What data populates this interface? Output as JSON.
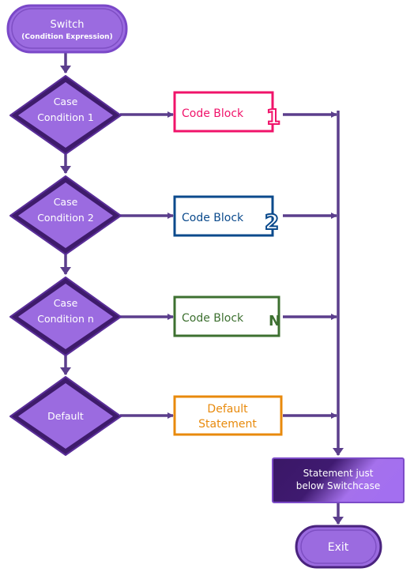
{
  "colors": {
    "connector": "#5b3e8c",
    "node_fill": "#9b6be0",
    "node_border": "#4a237f",
    "case1": "#f0136a",
    "case2": "#0b4a8c",
    "caseN": "#3d7030",
    "default": "#e88a0c"
  },
  "start": {
    "title": "Switch",
    "subtitle": "(Condition Expression)"
  },
  "conditions": [
    {
      "line1": "Case",
      "line2": "Condition 1"
    },
    {
      "line1": "Case",
      "line2": "Condition 2"
    },
    {
      "line1": "Case",
      "line2": "Condition n"
    },
    {
      "line1": "",
      "line2": "Default"
    }
  ],
  "blocks": [
    {
      "label": "Code Block",
      "badge": "1"
    },
    {
      "label": "Code Block",
      "badge": "2"
    },
    {
      "label": "Code Block",
      "badge": "N"
    }
  ],
  "default_block": {
    "line1": "Default",
    "line2": "Statement"
  },
  "after": {
    "line1": "Statement just",
    "line2": "below Switchcase"
  },
  "exit": {
    "label": "Exit"
  }
}
